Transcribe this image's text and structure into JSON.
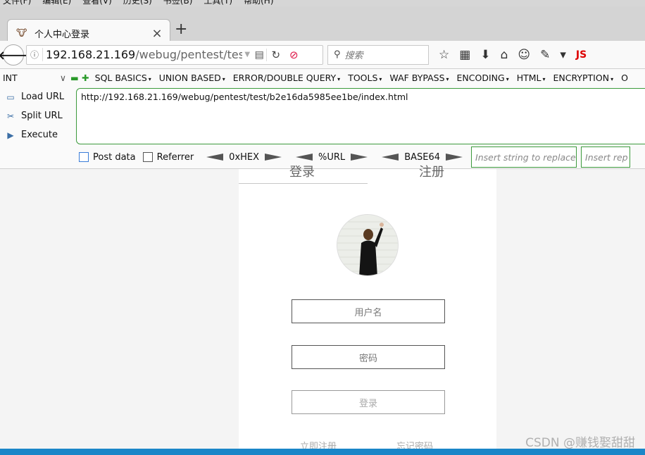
{
  "menubar": [
    "文件(F)",
    "编辑(E)",
    "查看(V)",
    "历史(S)",
    "书签(B)",
    "工具(T)",
    "帮助(H)"
  ],
  "tab": {
    "title": "个人中心登录",
    "close": "×",
    "new": "+"
  },
  "navbar": {
    "url_host": "192.168.21.169",
    "url_path": "/webug/pentest/test/",
    "search_placeholder": "搜索",
    "js_label": "JS"
  },
  "hackbar": {
    "select_value": "INT",
    "menu": [
      "SQL BASICS",
      "UNION BASED",
      "ERROR/DOUBLE QUERY",
      "TOOLS",
      "WAF BYPASS",
      "ENCODING",
      "HTML",
      "ENCRYPTION",
      "O"
    ],
    "side": {
      "load": "Load URL",
      "split": "Split URL",
      "execute": "Execute"
    },
    "url_value": "http://192.168.21.169/webug/pentest/test/b2e16da5985ee1be/index.html",
    "post_data": "Post data",
    "referrer": "Referrer",
    "hex": "0xHEX",
    "urlenc": "%URL",
    "base64": "BASE64",
    "replace_placeholder": "Insert string to replace",
    "replace_with_placeholder": "Insert rep"
  },
  "page": {
    "tab_login": "登录",
    "tab_register": "注册",
    "username_placeholder": "用户名",
    "password_placeholder": "密码",
    "login_button": "登录",
    "register_link": "立即注册",
    "forgot_link": "忘记密码"
  },
  "watermark": "CSDN @赚钱娶甜甜",
  "colors": {
    "hackbar_green": "#3c9a3c",
    "taskbar": "#1a86c8"
  }
}
